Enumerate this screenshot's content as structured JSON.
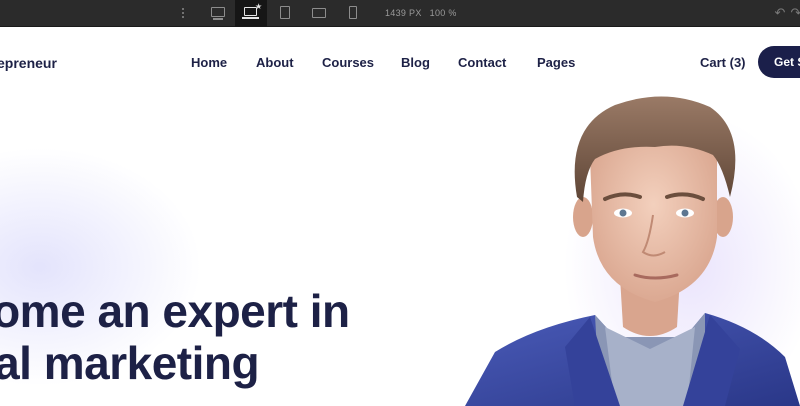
{
  "toolbar": {
    "devices": [
      {
        "name": "desktop-large",
        "active": false
      },
      {
        "name": "laptop",
        "active": true
      },
      {
        "name": "tablet",
        "active": false
      },
      {
        "name": "tablet-landscape",
        "active": false
      },
      {
        "name": "mobile",
        "active": false
      }
    ],
    "width_value": "1439",
    "width_unit": "PX",
    "zoom_value": "100",
    "zoom_unit": "%"
  },
  "site": {
    "brand": "epreneur",
    "nav": [
      "Home",
      "About",
      "Courses",
      "Blog",
      "Contact",
      "Pages"
    ],
    "cart": "Cart (3)",
    "cta": "Get Started",
    "headline_line1": "come an expert in",
    "headline_line2": "ital marketing"
  },
  "colors": {
    "navy": "#1d2146",
    "button": "#1b1f4a",
    "toolbar": "#2b2b2b",
    "suit": "#3a4aa0"
  }
}
